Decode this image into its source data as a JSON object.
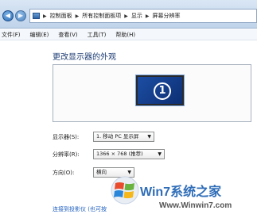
{
  "address_bar": {
    "crumbs": [
      "控制面板",
      "所有控制面板项",
      "显示",
      "屏幕分辨率"
    ]
  },
  "menu": [
    "文件(F)",
    "编辑(E)",
    "查看(V)",
    "工具(T)",
    "帮助(H)"
  ],
  "page_title": "更改显示器的外观",
  "monitor_number": "1",
  "display": {
    "label": "显示器(S):",
    "value": "1. 移动 PC 显示屏"
  },
  "resolution": {
    "label": "分辨率(R):",
    "value": "1366 × 768 (推荐)"
  },
  "orientation": {
    "label": "方向(O):",
    "value": "横向"
  },
  "projector_link": "连接到投影仪 (也可按",
  "watermark": {
    "brand": "Win7系统之家",
    "url": "Www.Winwin7.com"
  }
}
